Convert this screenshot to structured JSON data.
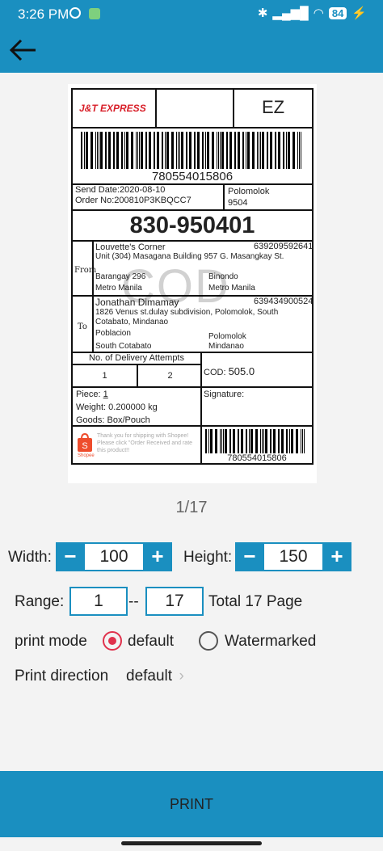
{
  "status": {
    "time": "3:26 PM",
    "battery": "84"
  },
  "label": {
    "brand_logo": "J&T EXPRESS",
    "service_code": "EZ",
    "tracking_number": "780554015806",
    "send_date": "Send Date:2020-08-10",
    "order_no": "Order No:200810P3KBQCC7",
    "dest_city": "Polomolok",
    "dest_code": "9504",
    "sort_code": "830-950401",
    "from_label": "From",
    "sender": {
      "name": "Louvette's Corner",
      "phone": "639209592641",
      "address": "Unit (304) Masagana Building 957 G. Masangkay St.",
      "barangay": "Barangay 296",
      "city": "Binondo",
      "province": "Metro Manila",
      "region": "Metro Manila"
    },
    "to_label": "To",
    "receiver": {
      "name": "Jonathan Dimamay",
      "phone": "639434900524",
      "address": "1826 Venus st.dulay subdivision, Polomolok, South Cotabato, Mindanao",
      "barangay": "Poblacion",
      "city": "Polomolok",
      "province": "South Cotabato",
      "region": "Mindanao"
    },
    "watermark": "COD",
    "attempts_title": "No. of Delivery Attempts",
    "attempt_1": "1",
    "attempt_2": "2",
    "cod_label": "COD:",
    "cod_value": "505.0",
    "piece_label": "Piece:",
    "piece_value": "1",
    "weight": "Weight:  0.200000 kg",
    "goods": "Goods: Box/Pouch",
    "signature_label": "Signature:",
    "shopee_text": "Thank you for shipping with Shopee! Please click \"Order Received and rate this product!!",
    "shopee_logo": "Shopee"
  },
  "pager": {
    "text": "1/17"
  },
  "controls": {
    "width_label": "Width:",
    "width_value": "100",
    "height_label": "Height:",
    "height_value": "150",
    "minus": "−",
    "plus": "+",
    "range_label": "Range:",
    "range_from": "1",
    "range_sep": "--",
    "range_to": "17",
    "total": "Total 17 Page",
    "print_mode_label": "print mode",
    "mode_default": "default",
    "mode_watermarked": "Watermarked",
    "direction_label": "Print direction",
    "direction_value": "default"
  },
  "print_button": "PRINT",
  "colors": {
    "accent": "#1a8fc0",
    "radio": "#e0314c",
    "shopee": "#ee4d2d",
    "jt_red": "#d81e28"
  }
}
